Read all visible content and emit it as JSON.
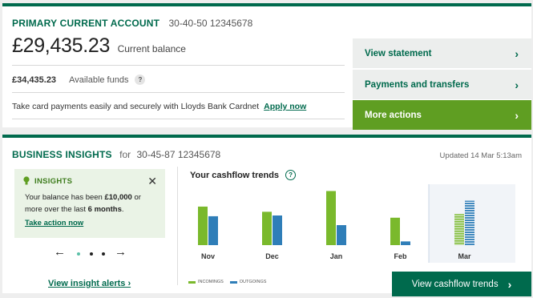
{
  "account": {
    "name": "PRIMARY CURRENT ACCOUNT",
    "number": "30-40-50 12345678",
    "balance": "£29,435.23",
    "balance_label": "Current balance",
    "available_amount": "£34,435.23",
    "available_label": "Available funds",
    "help_glyph": "?",
    "promo_text": "Take card payments easily and securely with Lloyds Bank Cardnet",
    "promo_link": "Apply now"
  },
  "actions": [
    {
      "label": "View statement"
    },
    {
      "label": "Payments and transfers"
    },
    {
      "label": "More actions"
    }
  ],
  "insights": {
    "title": "BUSINESS INSIGHTS",
    "for_label": "for",
    "account_number": "30-45-87 12345678",
    "updated": "Updated 14 Mar 5:13am",
    "card": {
      "label": "INSIGHTS",
      "text_before": "Your balance has been ",
      "text_bold": "£10,000",
      "text_middle": " or more over the last ",
      "text_bold2": "6 months",
      "text_after": ".",
      "action": "Take action now",
      "close_glyph": "✕"
    },
    "carousel": {
      "prev_glyph": "←",
      "next_glyph": "→",
      "active_index": 0,
      "count": 3
    },
    "alerts_link": "View insight alerts ›"
  },
  "cashflow": {
    "title": "Your cashflow trends",
    "help_glyph": "?",
    "button_label": "View cashflow trends",
    "legend": [
      {
        "label": "INCOMINGS",
        "color": "#7ab92c"
      },
      {
        "label": "OUTGOINGS",
        "color": "#2f7eb8"
      }
    ]
  },
  "chart_data": {
    "type": "bar",
    "categories": [
      "Nov",
      "Dec",
      "Jan",
      "Feb",
      "Mar"
    ],
    "series": [
      {
        "name": "INCOMINGS",
        "values": [
          52,
          45,
          73,
          37,
          42
        ],
        "color": "#7ab92c"
      },
      {
        "name": "OUTGOINGS",
        "values": [
          39,
          40,
          27,
          5,
          60
        ],
        "color": "#2f7eb8"
      }
    ],
    "highlighted_category": "Mar",
    "ylim": [
      0,
      80
    ],
    "grid": false
  },
  "colors": {
    "brand_green": "#006a4d",
    "action_green": "#5f9e22",
    "insight_bg": "#eaf3e6"
  }
}
